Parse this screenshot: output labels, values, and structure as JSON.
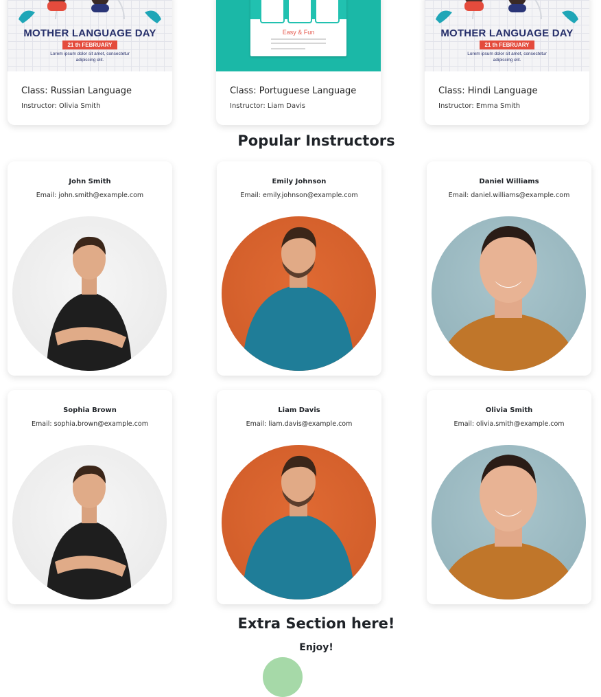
{
  "classes": [
    {
      "title": "Class: Russian Language",
      "instructor": "Instructor: Olivia Smith",
      "poster": {
        "heading": "MOTHER LANGUAGE DAY",
        "date": "21 th FEBRUARY",
        "text": "Lorem ipsum dolor sit amet, consectetur adipiscing elit."
      }
    },
    {
      "title": "Class: Portuguese Language",
      "instructor": "Instructor: Liam Davis",
      "poster": {
        "tagline": "Easy & Fun"
      }
    },
    {
      "title": "Class: Hindi Language",
      "instructor": "Instructor: Emma Smith",
      "poster": {
        "heading": "MOTHER LANGUAGE DAY",
        "date": "21 th FEBRUARY",
        "text": "Lorem ipsum dolor sit amet, consectetur adipiscing elit."
      }
    }
  ],
  "popular_instructors": {
    "title": "Popular Instructors",
    "items": [
      {
        "name": "John Smith",
        "email": "Email: john.smith@example.com",
        "photo_style": "grey"
      },
      {
        "name": "Emily Johnson",
        "email": "Email: emily.johnson@example.com",
        "photo_style": "orange"
      },
      {
        "name": "Daniel Williams",
        "email": "Email: daniel.williams@example.com",
        "photo_style": "blue"
      },
      {
        "name": "Sophia Brown",
        "email": "Email: sophia.brown@example.com",
        "photo_style": "grey"
      },
      {
        "name": "Liam Davis",
        "email": "Email: liam.davis@example.com",
        "photo_style": "orange"
      },
      {
        "name": "Olivia Smith",
        "email": "Email: olivia.smith@example.com",
        "photo_style": "blue"
      }
    ]
  },
  "extra_section": {
    "title": "Extra Section here!",
    "subtitle": "Enjoy!"
  },
  "colors": {
    "accent_red": "#e44b3c",
    "navy": "#27306b",
    "teal": "#1bb8a7",
    "orange": "#d35f2b",
    "steel_blue": "#97b6be",
    "green": "#a6d9a8"
  }
}
